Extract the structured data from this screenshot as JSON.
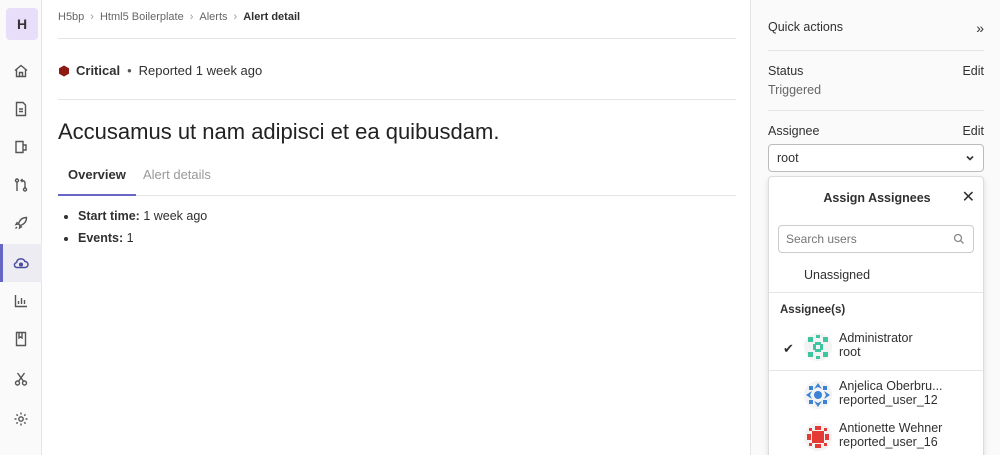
{
  "app": {
    "project_initial": "H",
    "accent_color": "#6666c4",
    "nav_icons": [
      "home-icon",
      "issues-icon",
      "merge-requests-icon",
      "repository-icon",
      "deployments-icon",
      "operations-icon",
      "analytics-icon",
      "wiki-icon",
      "snippets-icon",
      "settings-icon"
    ]
  },
  "breadcrumb": {
    "items": [
      "H5bp",
      "Html5 Boilerplate",
      "Alerts"
    ],
    "current": "Alert detail"
  },
  "alert": {
    "severity": "Critical",
    "severity_color": "#8d1b13",
    "reported_label": "Reported",
    "reported_time": "1 week ago",
    "title": "Accusamus ut nam adipisci et ea quibusdam."
  },
  "tabs": [
    {
      "label": "Overview",
      "active": true
    },
    {
      "label": "Alert details",
      "active": false
    }
  ],
  "overview": {
    "start_time_label": "Start time:",
    "start_time_value": "1 week ago",
    "events_label": "Events:",
    "events_value": "1"
  },
  "sidebar": {
    "quick_actions": "Quick actions",
    "collapse_glyph": "»",
    "status_label": "Status",
    "status_edit": "Edit",
    "status_value": "Triggered",
    "assignee_label": "Assignee",
    "assignee_edit": "Edit",
    "assignee_selected": "root"
  },
  "dropdown": {
    "title": "Assign Assignees",
    "search_placeholder": "Search users",
    "unassigned": "Unassigned",
    "section_label": "Assignee(s)",
    "users": [
      {
        "name": "Administrator",
        "username": "root",
        "checked": true,
        "avatar_color": "#3dc4a0"
      },
      {
        "name": "Anjelica Oberbru...",
        "username": "reported_user_12",
        "checked": false,
        "avatar_color": "#3b82d6"
      },
      {
        "name": "Antionette Wehner",
        "username": "reported_user_16",
        "checked": false,
        "avatar_color": "#e53935"
      }
    ]
  }
}
